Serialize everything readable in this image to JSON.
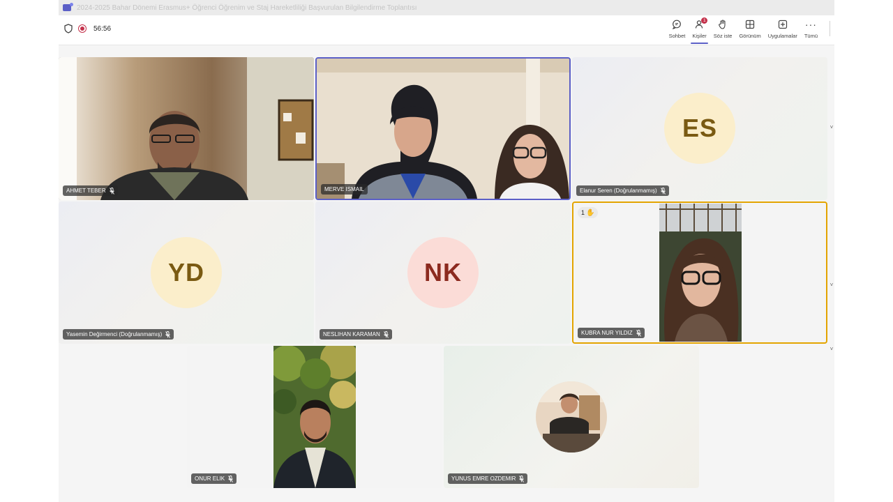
{
  "window": {
    "title": "2024-2025 Bahar Dönemi Erasmus+ Öğrenci Öğrenim ve Staj Hareketliliği Başvurulan Bilgilendirme Toplantısı"
  },
  "meeting": {
    "timer": "56:56",
    "recording": true
  },
  "toolbar": {
    "items": [
      {
        "label": "Sohbet",
        "icon": "chat-icon"
      },
      {
        "label": "Kişiler",
        "icon": "people-icon",
        "badge": "1",
        "active": true
      },
      {
        "label": "Söz iste",
        "icon": "raise-hand-icon"
      },
      {
        "label": "Görünüm",
        "icon": "layout-icon"
      },
      {
        "label": "Uygulamalar",
        "icon": "apps-icon"
      },
      {
        "label": "Tümü",
        "icon": "more-icon"
      }
    ]
  },
  "participants": [
    {
      "name": "AHMET TEBER",
      "type": "video",
      "muted": true
    },
    {
      "name": "MERVE ISMAIL",
      "type": "video",
      "muted": false,
      "speaking": true
    },
    {
      "name": "Elanur Seren (Doğrulanmamış)",
      "type": "avatar",
      "initials": "ES",
      "avatar_color": "#fbeecb",
      "muted": true
    },
    {
      "name": "Yasemin Değirmenci (Doğrulanmamış)",
      "type": "avatar",
      "initials": "YD",
      "avatar_color": "#fbeecb",
      "muted": true
    },
    {
      "name": "NESLIHAN KARAMAN",
      "type": "avatar",
      "initials": "NK",
      "avatar_color": "#fbdcd7",
      "muted": true
    },
    {
      "name": "KUBRA NUR YILDIZ",
      "type": "video",
      "muted": true,
      "hand_raised": true,
      "hand_order": "1"
    },
    {
      "name": "ONUR ELIK",
      "type": "video",
      "muted": true
    },
    {
      "name": "YUNUS EMRE OZDEMIR",
      "type": "photo-avatar",
      "muted": true
    }
  ],
  "colors": {
    "accent": "#5b5fc7",
    "raised_hand_border": "#e3a400",
    "record_red": "#c4314b"
  }
}
